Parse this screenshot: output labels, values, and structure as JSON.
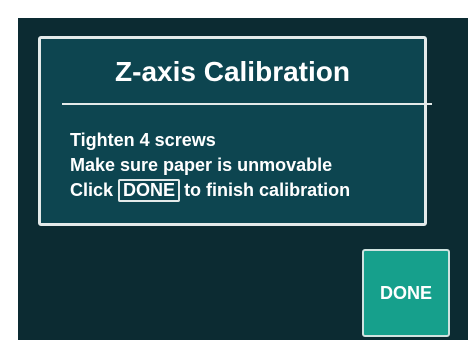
{
  "dialog": {
    "title": "Z-axis Calibration",
    "lines": [
      "Tighten 4 screws",
      "Make sure paper is unmovable"
    ],
    "last_line_prefix": "Click",
    "inline_button_label": "DONE",
    "last_line_suffix": "to finish calibration"
  },
  "done_button": {
    "label": "DONE"
  },
  "colors": {
    "background": "#0c2b32",
    "dialog": "#0d4550",
    "border": "#e4eaea",
    "button": "#16a08c"
  }
}
